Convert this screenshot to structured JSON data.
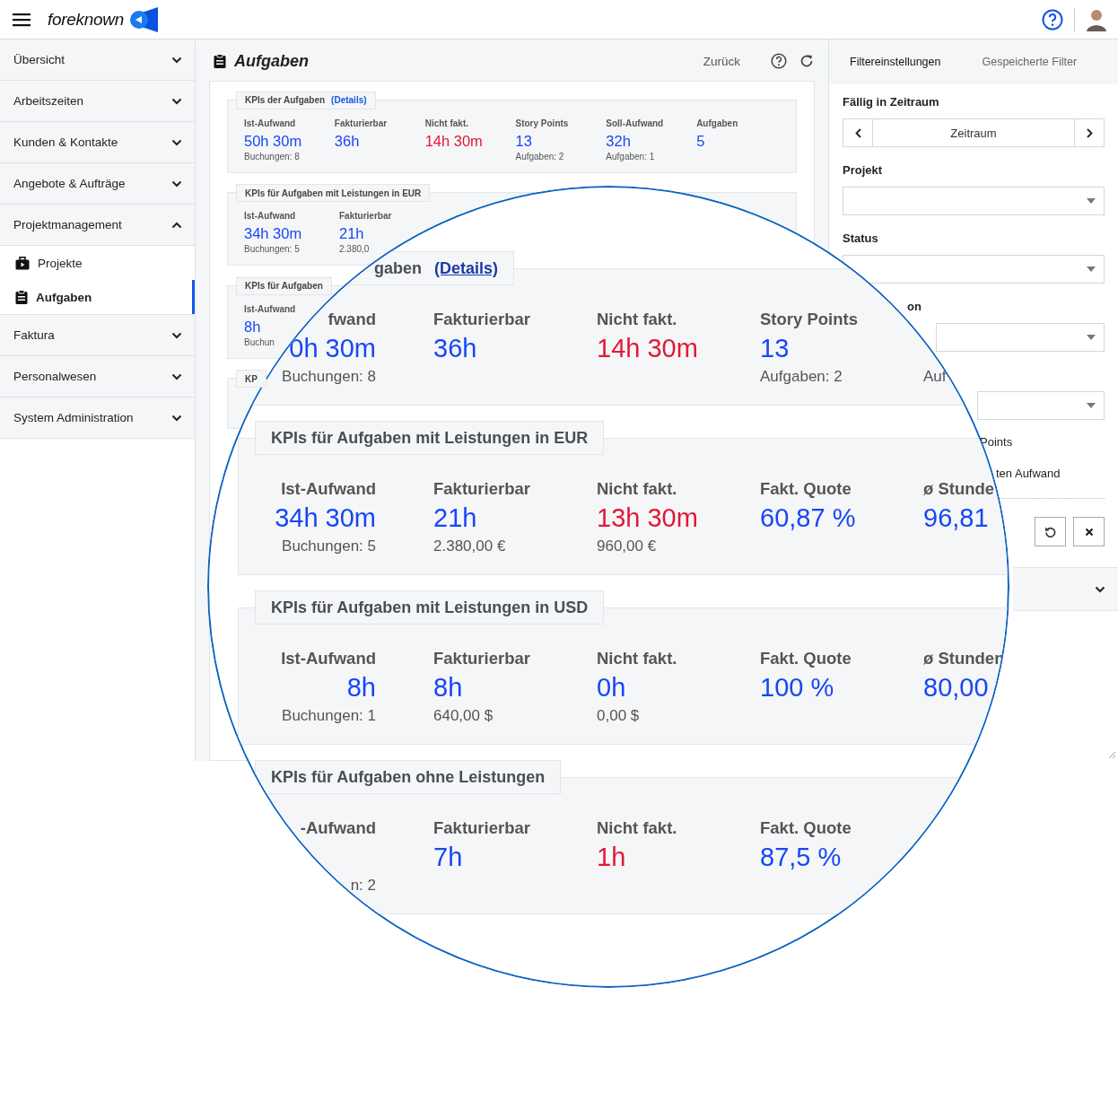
{
  "header": {
    "brand": "foreknown"
  },
  "sidebar": {
    "items": [
      {
        "label": "Übersicht",
        "expanded": false
      },
      {
        "label": "Arbeitszeiten",
        "expanded": false
      },
      {
        "label": "Kunden & Kontakte",
        "expanded": false
      },
      {
        "label": "Angebote & Aufträge",
        "expanded": false
      },
      {
        "label": "Projektmanagement",
        "expanded": true,
        "children": [
          {
            "label": "Projekte",
            "selected": false
          },
          {
            "label": "Aufgaben",
            "selected": true
          }
        ]
      },
      {
        "label": "Faktura",
        "expanded": false
      },
      {
        "label": "Personalwesen",
        "expanded": false
      },
      {
        "label": "System Administration",
        "expanded": false
      }
    ]
  },
  "page": {
    "title": "Aufgaben",
    "back_link": "Zurück"
  },
  "kpi_panels": [
    {
      "title": "KPIs der Aufgaben",
      "details_link": "(Details)",
      "metrics": [
        {
          "label": "Ist-Aufwand",
          "value": "50h 30m",
          "color": "#1747f5",
          "note": "Buchungen: 8"
        },
        {
          "label": "Fakturierbar",
          "value": "36h",
          "color": "#1747f5"
        },
        {
          "label": "Nicht fakt.",
          "value": "14h 30m",
          "color": "#e01935"
        },
        {
          "label": "Story Points",
          "value": "13",
          "color": "#1747f5",
          "note": "Aufgaben: 2"
        },
        {
          "label": "Soll-Aufwand",
          "value": "32h",
          "color": "#1747f5",
          "note": "Aufgaben: 1"
        },
        {
          "label": "Aufgaben",
          "value": "5",
          "color": "#1747f5"
        }
      ]
    },
    {
      "title": "KPIs für Aufgaben mit Leistungen in EUR",
      "metrics": [
        {
          "label": "Ist-Aufwand",
          "value": "34h 30m",
          "color": "#1747f5",
          "note": "Buchungen: 5"
        },
        {
          "label": "Fakturierbar",
          "value": "21h",
          "color": "#1747f5",
          "note": "2.380,0"
        }
      ]
    },
    {
      "title": "KPIs für Aufgaben",
      "metrics": [
        {
          "label": "Ist-Aufwand",
          "value": "8h",
          "color": "#1747f5",
          "note": "Buchun"
        }
      ]
    },
    {
      "title": "KP"
    }
  ],
  "filter_panel": {
    "tabs": [
      {
        "label": "Filtereinstellungen",
        "selected": true
      },
      {
        "label": "Gespeicherte Filter",
        "selected": false
      }
    ],
    "fields": [
      {
        "kind": "range",
        "label": "Fällig in Zeitraum",
        "value": "Zeitraum"
      },
      {
        "kind": "select",
        "label": "Projekt"
      },
      {
        "kind": "select",
        "label": "Status"
      },
      {
        "kind": "select",
        "label": "on"
      },
      {
        "kind": "select"
      },
      {
        "kind": "checkbox",
        "label": "Points"
      },
      {
        "kind": "checkbox",
        "label": "ten Aufwand"
      }
    ]
  },
  "magnifier": {
    "panels": [
      {
        "title": "gaben",
        "details_link": "(Details)",
        "metrics": [
          {
            "label": "fwand",
            "value": "0h 30m",
            "color": "#1747f5",
            "note": "Buchungen: 8"
          },
          {
            "label": "Fakturierbar",
            "value": "36h",
            "color": "#1747f5"
          },
          {
            "label": "Nicht fakt.",
            "value": "14h 30m",
            "color": "#e01935"
          },
          {
            "label": "Story Points",
            "value": "13",
            "color": "#1747f5",
            "note": "Aufgaben: 2"
          },
          {
            "note": "Auf"
          }
        ]
      },
      {
        "title": "KPIs für Aufgaben mit Leistungen in EUR",
        "metrics": [
          {
            "label": "Ist-Aufwand",
            "value": "34h 30m",
            "color": "#1747f5",
            "note": "Buchungen: 5"
          },
          {
            "label": "Fakturierbar",
            "value": "21h",
            "color": "#1747f5",
            "note": "2.380,00 €"
          },
          {
            "label": "Nicht fakt.",
            "value": "13h 30m",
            "color": "#e01935",
            "note": "960,00 €"
          },
          {
            "label": "Fakt. Quote",
            "value": "60,87 %",
            "color": "#1747f5"
          },
          {
            "label": "ø Stunde",
            "value": "96,81",
            "color": "#1747f5"
          }
        ]
      },
      {
        "title": "KPIs für Aufgaben mit Leistungen in USD",
        "metrics": [
          {
            "label": "Ist-Aufwand",
            "value": "8h",
            "color": "#1747f5",
            "note": "Buchungen: 1"
          },
          {
            "label": "Fakturierbar",
            "value": "8h",
            "color": "#1747f5",
            "note": "640,00 $"
          },
          {
            "label": "Nicht fakt.",
            "value": "0h",
            "color": "#1747f5",
            "note": "0,00 $"
          },
          {
            "label": "Fakt. Quote",
            "value": "100 %",
            "color": "#1747f5"
          },
          {
            "label": "ø Stunden",
            "value": "80,00",
            "color": "#1747f5"
          }
        ]
      },
      {
        "title": "KPIs für Aufgaben ohne Leistungen",
        "metrics": [
          {
            "label": "-Aufwand",
            "note": "n: 2"
          },
          {
            "label": "Fakturierbar",
            "value": "7h",
            "color": "#1747f5"
          },
          {
            "label": "Nicht fakt.",
            "value": "1h",
            "color": "#e01935"
          },
          {
            "label": "Fakt. Quote",
            "value": "87,5 %",
            "color": "#1747f5"
          }
        ]
      }
    ]
  }
}
